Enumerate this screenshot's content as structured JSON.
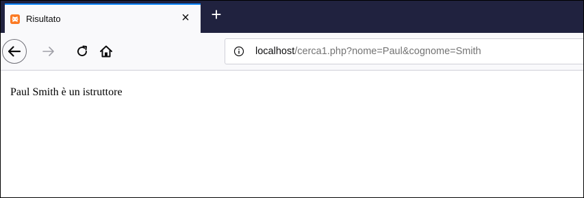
{
  "browser": {
    "tab": {
      "title": "Risultato",
      "favicon": "xampp-icon",
      "close_symbol": "×"
    },
    "new_tab_symbol": "+",
    "toolbar": {
      "back": "back-arrow-icon",
      "forward": "forward-arrow-icon",
      "reload": "reload-icon",
      "home": "home-icon"
    },
    "url": {
      "host": "localhost",
      "path": "/cerca1.php?nome=Paul&cognome=Smith"
    }
  },
  "page": {
    "text": "Paul Smith è un istruttore"
  },
  "colors": {
    "tabstrip_bg": "#20223f",
    "active_tab_accent": "#0a84ff",
    "favicon_orange": "#fb7a24"
  }
}
